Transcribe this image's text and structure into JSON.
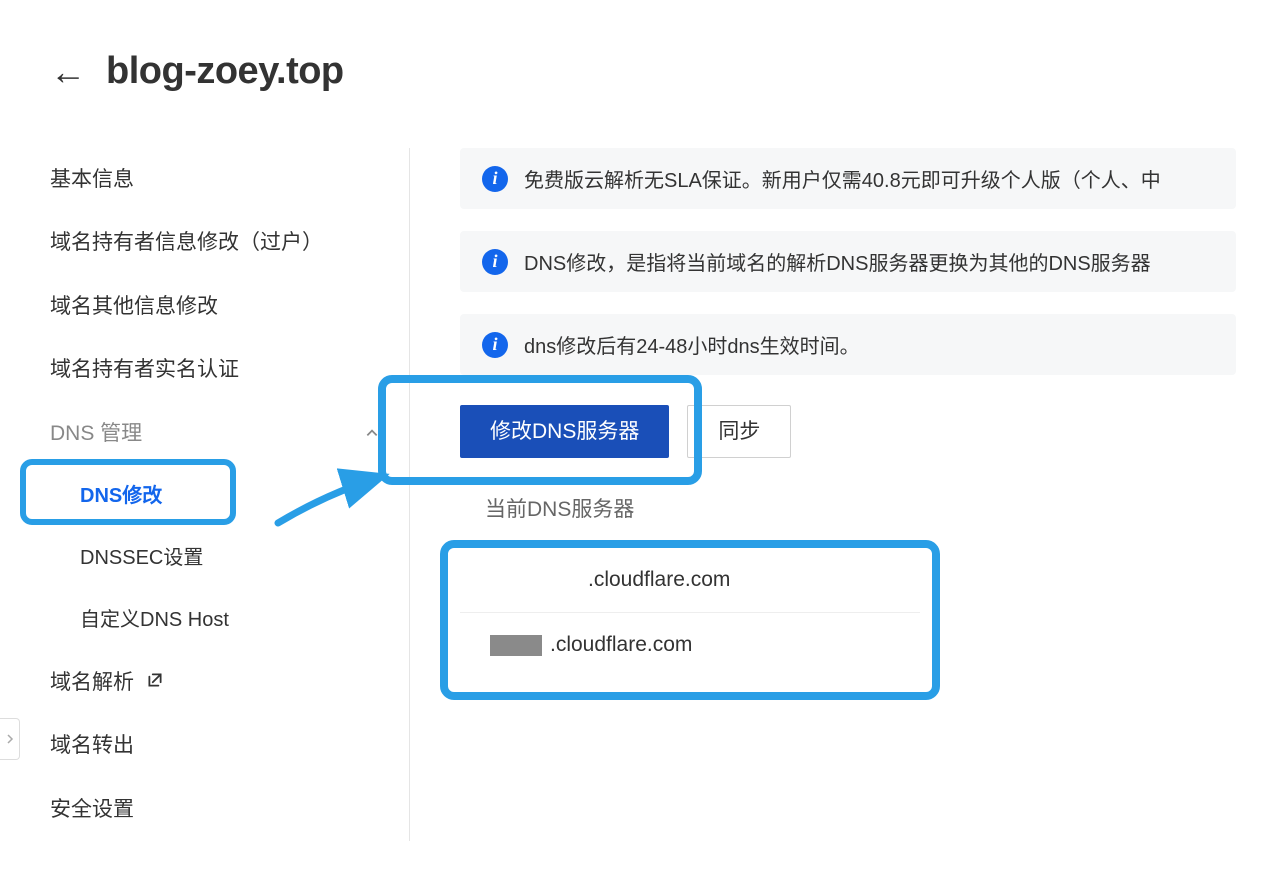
{
  "header": {
    "domain_name": "blog-zoey.top"
  },
  "sidebar": {
    "items": [
      {
        "label": "基本信息",
        "type": "item"
      },
      {
        "label": "域名持有者信息修改（过户）",
        "type": "item"
      },
      {
        "label": "域名其他信息修改",
        "type": "item"
      },
      {
        "label": "域名持有者实名认证",
        "type": "item"
      },
      {
        "label": "DNS 管理",
        "type": "group"
      },
      {
        "label": "DNS修改",
        "type": "sub",
        "active": true
      },
      {
        "label": "DNSSEC设置",
        "type": "sub"
      },
      {
        "label": "自定义DNS Host",
        "type": "sub"
      },
      {
        "label": "域名解析",
        "type": "item",
        "external": true
      },
      {
        "label": "域名转出",
        "type": "item"
      },
      {
        "label": "安全设置",
        "type": "item"
      }
    ]
  },
  "banners": {
    "b1": "免费版云解析无SLA保证。新用户仅需40.8元即可升级个人版（个人、中",
    "b2": "DNS修改，是指将当前域名的解析DNS服务器更换为其他的DNS服务器",
    "b3": "dns修改后有24-48小时dns生效时间。"
  },
  "buttons": {
    "modify_dns": "修改DNS服务器",
    "sync": "同步"
  },
  "dns": {
    "section_label": "当前DNS服务器",
    "server1_suffix": ".cloudflare.com",
    "server2_suffix": ".cloudflare.com"
  }
}
